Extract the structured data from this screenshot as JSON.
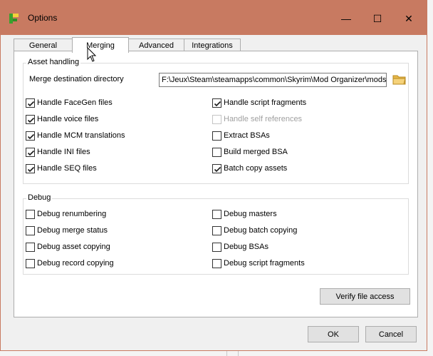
{
  "window": {
    "title": "Options"
  },
  "titlebar": {
    "minimize": "—",
    "maximize": "☐",
    "close": "✕"
  },
  "tabs": [
    {
      "label": "General",
      "active": false
    },
    {
      "label": "Merging",
      "active": true
    },
    {
      "label": "Advanced",
      "active": false
    },
    {
      "label": "Integrations",
      "active": false
    }
  ],
  "asset_handling": {
    "title": "Asset handling",
    "merge_dir_label": "Merge destination directory",
    "merge_dir_value": "F:\\Jeux\\Steam\\steamapps\\common\\Skyrim\\Mod Organizer\\mods\\",
    "left": [
      {
        "label": "Handle FaceGen files",
        "checked": true,
        "enabled": true
      },
      {
        "label": "Handle voice files",
        "checked": true,
        "enabled": true
      },
      {
        "label": "Handle MCM translations",
        "checked": true,
        "enabled": true
      },
      {
        "label": "Handle INI files",
        "checked": true,
        "enabled": true
      },
      {
        "label": "Handle SEQ files",
        "checked": true,
        "enabled": true
      }
    ],
    "right": [
      {
        "label": "Handle script fragments",
        "checked": true,
        "enabled": true
      },
      {
        "label": "Handle self references",
        "checked": false,
        "enabled": false
      },
      {
        "label": "Extract BSAs",
        "checked": false,
        "enabled": true
      },
      {
        "label": "Build merged BSA",
        "checked": false,
        "enabled": true
      },
      {
        "label": "Batch copy assets",
        "checked": true,
        "enabled": true
      }
    ]
  },
  "debug": {
    "title": "Debug",
    "left": [
      {
        "label": "Debug renumbering",
        "checked": false,
        "enabled": true
      },
      {
        "label": "Debug merge status",
        "checked": false,
        "enabled": true
      },
      {
        "label": "Debug asset copying",
        "checked": false,
        "enabled": true
      },
      {
        "label": "Debug record copying",
        "checked": false,
        "enabled": true
      }
    ],
    "right": [
      {
        "label": "Debug masters",
        "checked": false,
        "enabled": true
      },
      {
        "label": "Debug batch copying",
        "checked": false,
        "enabled": true
      },
      {
        "label": "Debug BSAs",
        "checked": false,
        "enabled": true
      },
      {
        "label": "Debug script fragments",
        "checked": false,
        "enabled": true
      }
    ]
  },
  "buttons": {
    "verify": "Verify file access",
    "ok": "OK",
    "cancel": "Cancel"
  },
  "colors": {
    "titlebar": "#c87a61",
    "folder_icon": "#e8b84a"
  }
}
